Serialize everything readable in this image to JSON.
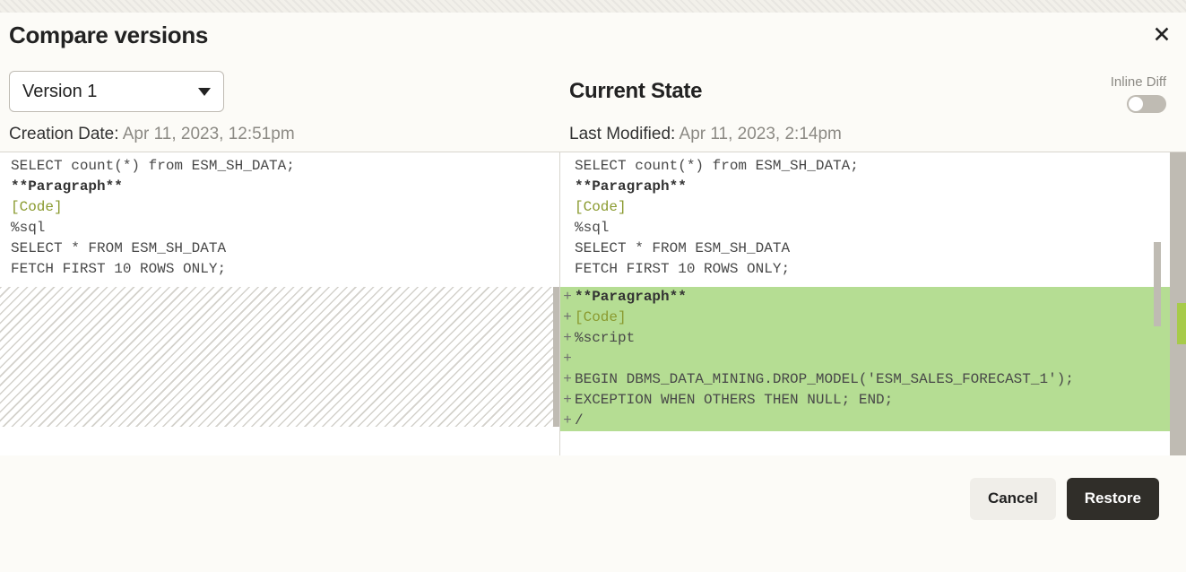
{
  "header": {
    "title": "Compare versions"
  },
  "toolbar": {
    "inline_diff_label": "Inline Diff",
    "inline_diff_on": false
  },
  "left": {
    "version_selected": "Version 1",
    "creation_date_label": "Creation Date:",
    "creation_date_value": "Apr 11, 2023, 12:51pm",
    "lines": [
      "SELECT count(*) from ESM_SH_DATA;",
      "",
      "**Paragraph**",
      "[Code]",
      "%sql",
      "SELECT * FROM ESM_SH_DATA",
      "FETCH FIRST 10 ROWS ONLY;"
    ]
  },
  "right": {
    "heading": "Current State",
    "last_modified_label": "Last Modified:",
    "last_modified_value": "Apr 11, 2023, 2:14pm",
    "common_lines": [
      "SELECT count(*) from ESM_SH_DATA;",
      "",
      "**Paragraph**",
      "[Code]",
      "%sql",
      "SELECT * FROM ESM_SH_DATA",
      "FETCH FIRST 10 ROWS ONLY;"
    ],
    "added_lines": [
      "**Paragraph**",
      "[Code]",
      "%script",
      "",
      "BEGIN DBMS_DATA_MINING.DROP_MODEL('ESM_SALES_FORECAST_1');",
      "EXCEPTION WHEN OTHERS THEN NULL; END;",
      "/"
    ]
  },
  "footer": {
    "cancel_label": "Cancel",
    "restore_label": "Restore"
  }
}
